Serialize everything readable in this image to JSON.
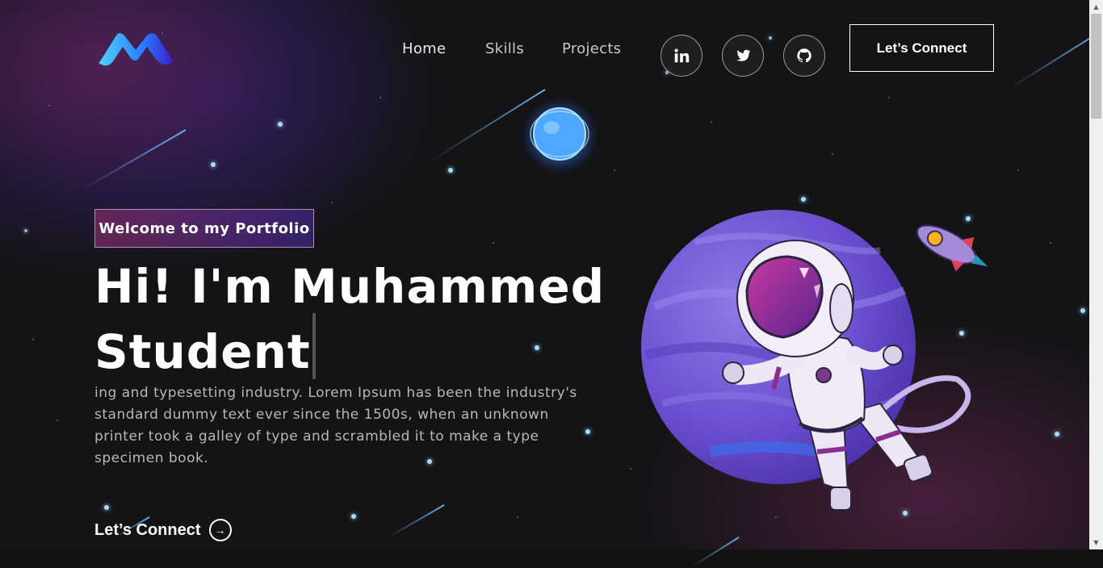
{
  "header": {
    "logo": "logo-icon",
    "nav": [
      {
        "label": "Home"
      },
      {
        "label": "Skills"
      },
      {
        "label": "Projects"
      }
    ],
    "social": [
      {
        "name": "linkedin-icon"
      },
      {
        "name": "twitter-icon"
      },
      {
        "name": "github-icon"
      }
    ],
    "connect_label": "Let’s Connect"
  },
  "hero": {
    "tagline": "Welcome to my Portfolio",
    "headline_line1": "Hi! I'm Muhammed",
    "headline_line2": "Student",
    "description": "ing and typesetting industry. Lorem Ipsum has been the industry's standard dummy text ever since the 1500s, when an unknown printer took a galley of type and scrambled it to make a type specimen book.",
    "cta_label": "Let’s Connect",
    "cta_icon": "arrow-right-circle-icon",
    "illustration": "astronaut-planet-illustration"
  },
  "colors": {
    "background": "#121212",
    "gradient_start": "#AA367C",
    "gradient_end": "#4A2FBD",
    "planet": "#7b5ad6",
    "accent_blue": "#4aa8ff"
  }
}
